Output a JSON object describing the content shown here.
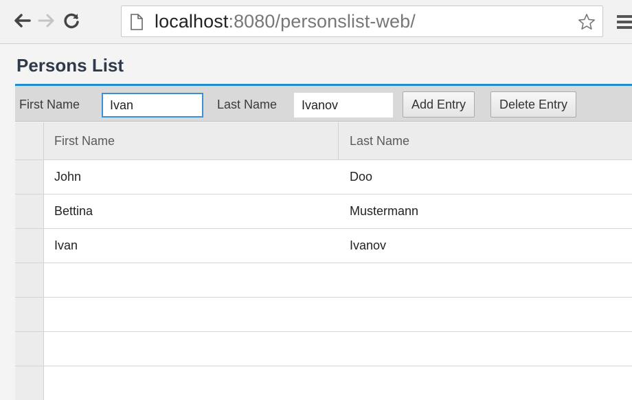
{
  "browser": {
    "url_host": "localhost",
    "url_rest": ":8080/personslist-web/",
    "icons": [
      "back-arrow-icon",
      "forward-arrow-icon",
      "reload-icon",
      "page-icon",
      "star-icon",
      "menu-icon"
    ]
  },
  "app": {
    "title": "Persons List"
  },
  "toolbar": {
    "first_name_label": "First Name",
    "first_name_value": "Ivan",
    "last_name_label": "Last Name",
    "last_name_value": "Ivanov",
    "add_label": "Add Entry",
    "delete_label": "Delete Entry"
  },
  "table": {
    "columns": [
      "First Name",
      "Last Name"
    ],
    "rows": [
      [
        "John",
        "Doo"
      ],
      [
        "Bettina",
        "Mustermann"
      ],
      [
        "Ivan",
        "Ivanov"
      ]
    ]
  },
  "colors": {
    "accent": "#1c8ed0",
    "focus": "#3a8fd8"
  }
}
